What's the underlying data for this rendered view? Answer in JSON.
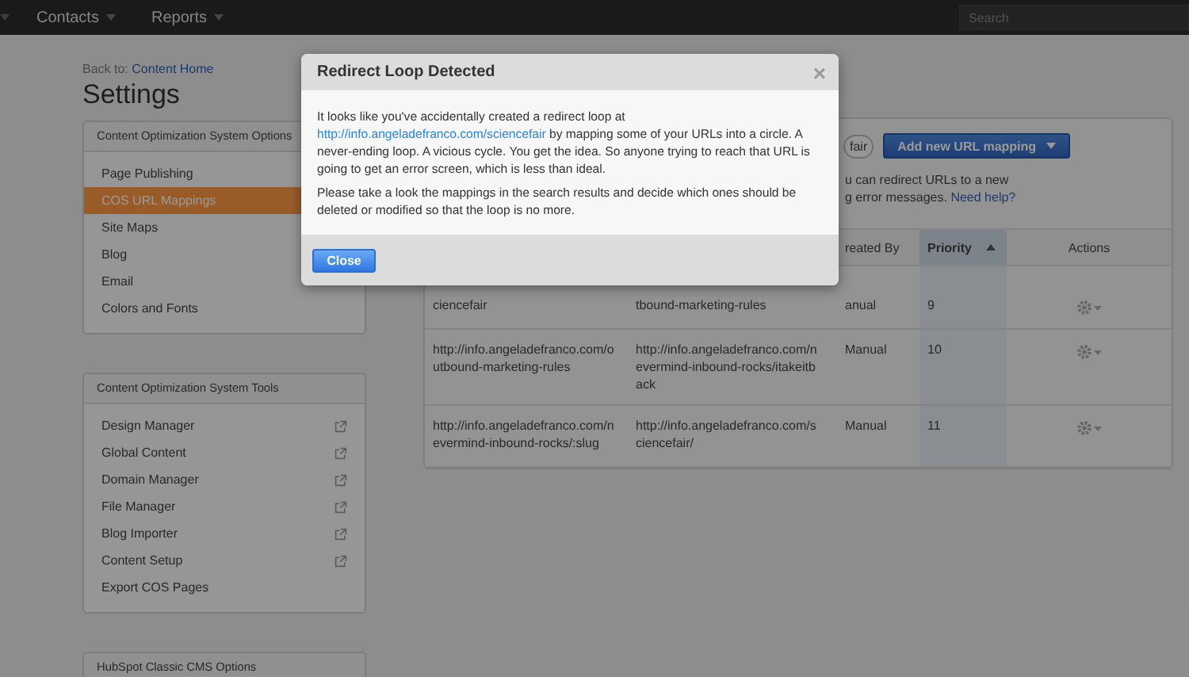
{
  "nav": {
    "items": [
      {
        "label": "Contacts"
      },
      {
        "label": "Reports"
      }
    ],
    "search": {
      "placeholder": "Search"
    }
  },
  "breadcrumb": {
    "prefix": "Back to:",
    "link": "Content Home"
  },
  "title": "Settings",
  "sidebar": {
    "panels": [
      {
        "title": "Content Optimization System Options",
        "items": [
          {
            "label": "Page Publishing",
            "selected": false
          },
          {
            "label": "COS URL Mappings",
            "selected": true
          },
          {
            "label": "Site Maps",
            "selected": false
          },
          {
            "label": "Blog",
            "selected": false
          },
          {
            "label": "Email",
            "selected": false
          },
          {
            "label": "Colors and Fonts",
            "selected": false
          }
        ]
      },
      {
        "title": "Content Optimization System Tools",
        "items": [
          {
            "label": "Design Manager",
            "selected": false,
            "external": true
          },
          {
            "label": "Global Content",
            "selected": false,
            "external": true
          },
          {
            "label": "Domain Manager",
            "selected": false,
            "external": true
          },
          {
            "label": "File Manager",
            "selected": false,
            "external": true
          },
          {
            "label": "Blog Importer",
            "selected": false,
            "external": true
          },
          {
            "label": "Content Setup",
            "selected": false,
            "external": true
          },
          {
            "label": "Export COS Pages",
            "selected": false,
            "external": false
          }
        ]
      },
      {
        "title": "HubSpot Classic CMS Options"
      }
    ]
  },
  "toolbar": {
    "partial_button": "fair",
    "add_button": "Add new URL mapping",
    "note_lines": [
      "u can redirect URLs to a new",
      "g error messages."
    ],
    "help_link": "Need help?"
  },
  "table": {
    "columns": [
      null,
      null,
      {
        "label": "reated By",
        "sorted": false
      },
      {
        "label": "Priority",
        "sorted": true
      },
      {
        "label": "Actions",
        "sorted": false
      }
    ],
    "rows": [
      {
        "cells": [
          "ciencefair",
          "tbound-marketing-rules",
          "anual",
          "9"
        ]
      },
      {
        "cells": [
          "http://info.angeladefranco.com/outbound-marketing-rules",
          "http://info.angeladefranco.com/nevermind-inbound-rocks/itakeitback",
          "Manual",
          "10"
        ]
      },
      {
        "cells": [
          "http://info.angeladefranco.com/nevermind-inbound-rocks/:slug",
          "http://info.angeladefranco.com/sciencefair/",
          "Manual",
          "11"
        ]
      }
    ]
  },
  "modal": {
    "title": "Redirect Loop Detected",
    "close_symbol": "×",
    "paragraphs": [
      {
        "before": "It looks like you've accidentally created a redirect loop at ",
        "link": "http://info.angeladefranco.com/sciencefair",
        "after": " by mapping some of your URLs into a circle. A never-ending loop. A vicious cycle. You get the idea. So anyone trying to reach that URL is going to get an error screen, which is less than ideal."
      },
      {
        "before": "Please take a look the mappings in the search results and decide which ones should be deleted or modified so that the loop is no more."
      }
    ],
    "button": "Close"
  }
}
